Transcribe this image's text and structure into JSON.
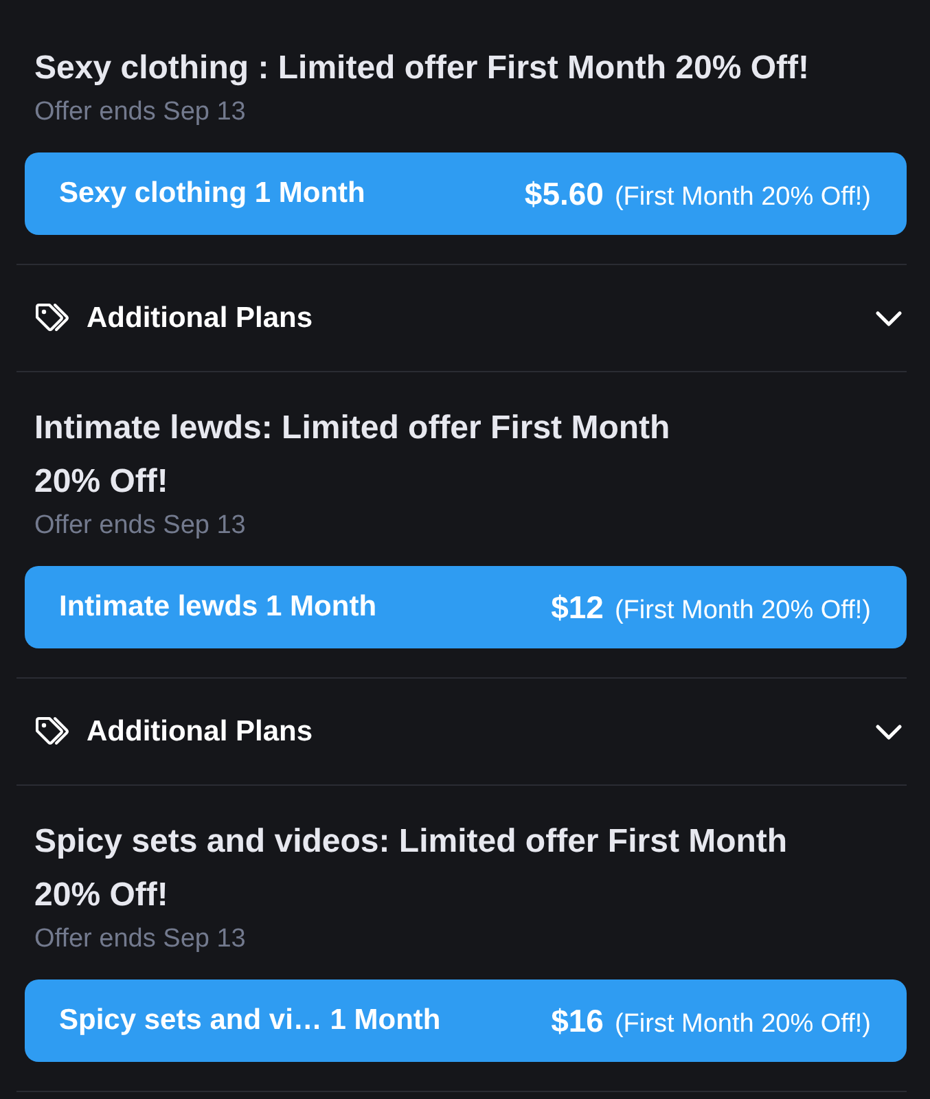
{
  "sections": [
    {
      "title": "Sexy clothing : Limited offer First Month 20% Off!",
      "offer_ends": "Offer ends Sep 13",
      "subscribe_button": {
        "label": "Sexy clothing 1 Month",
        "price": "$5.60",
        "note": "(First Month 20% Off!)"
      },
      "additional_plans": {
        "label": "Additional Plans",
        "expanded": false
      }
    },
    {
      "title": "Intimate lewds: Limited offer First Month\n20% Off!",
      "offer_ends": "Offer ends Sep 13",
      "subscribe_button": {
        "label": "Intimate lewds 1 Month",
        "price": "$12",
        "note": "(First Month 20% Off!)"
      },
      "additional_plans": {
        "label": "Additional Plans",
        "expanded": false
      }
    },
    {
      "title": "Spicy sets and videos: Limited offer First Month\n20% Off!",
      "offer_ends": "Offer ends Sep 13",
      "subscribe_button": {
        "label": "Spicy sets and vi… 1 Month",
        "price": "$16",
        "note": "(First Month 20% Off!)"
      }
    }
  ]
}
